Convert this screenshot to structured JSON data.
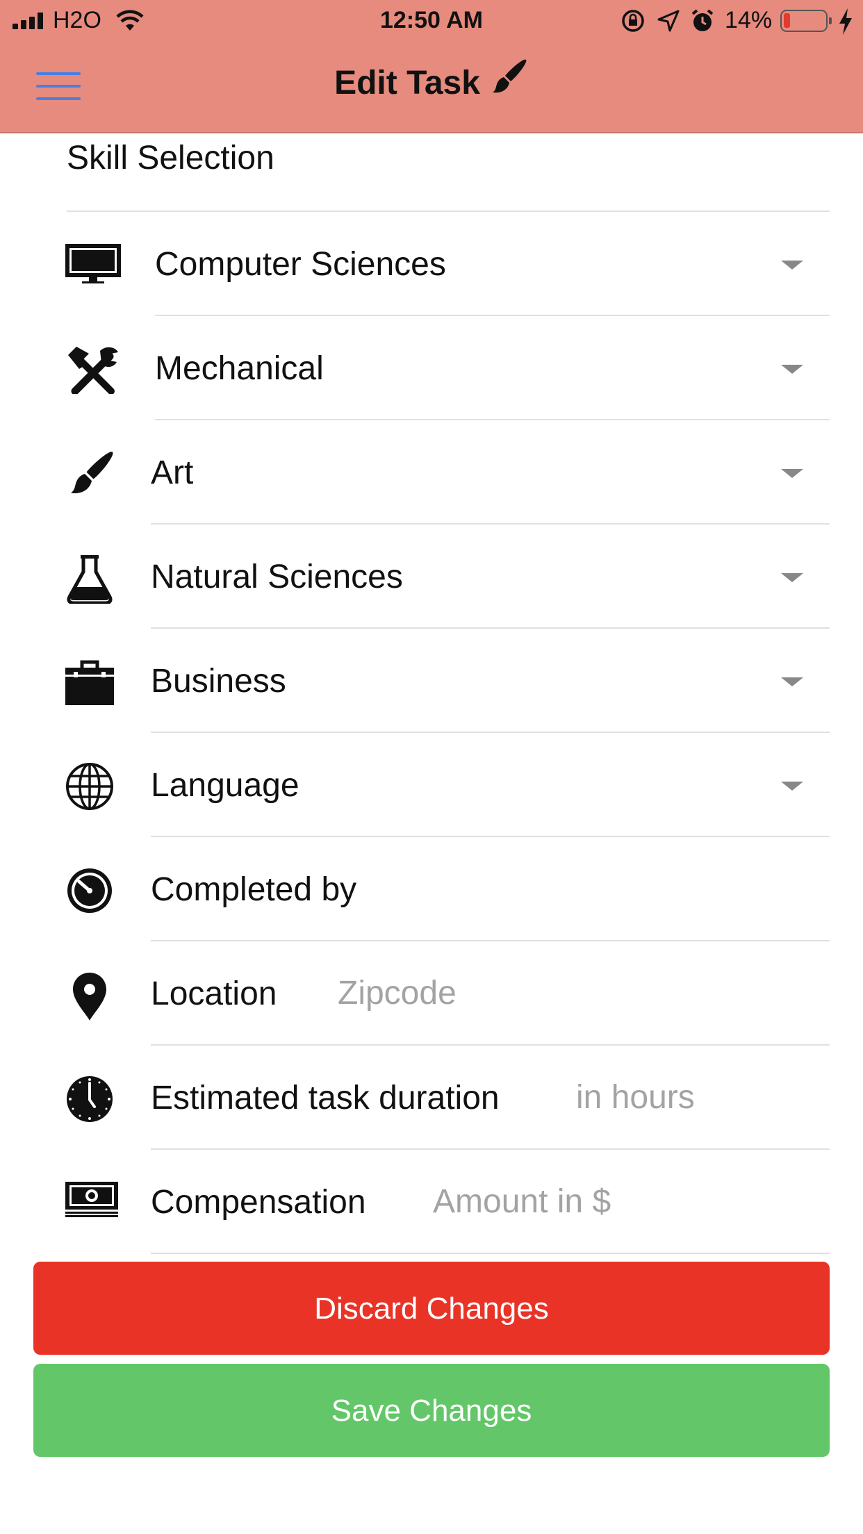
{
  "status_bar": {
    "carrier": "H2O",
    "time": "12:50 AM",
    "battery_percent": "14%",
    "battery_level": 0.14
  },
  "header": {
    "title": "Edit Task",
    "menu_icon": "hamburger-menu-icon",
    "title_icon": "paintbrush-icon",
    "background": "#e68b7e"
  },
  "form": {
    "section_title": "Skill Selection",
    "skills": [
      {
        "label": "Computer Sciences",
        "icon": "monitor-icon"
      },
      {
        "label": "Mechanical",
        "icon": "tools-icon"
      },
      {
        "label": "Art",
        "icon": "paintbrush-icon"
      },
      {
        "label": "Natural Sciences",
        "icon": "flask-icon"
      },
      {
        "label": "Business",
        "icon": "briefcase-icon"
      },
      {
        "label": "Language",
        "icon": "globe-icon"
      }
    ],
    "completed_by": {
      "label": "Completed by",
      "icon": "stopwatch-icon"
    },
    "location": {
      "label": "Location",
      "placeholder": "Zipcode",
      "value": "",
      "icon": "map-pin-icon"
    },
    "duration": {
      "label": "Estimated task duration",
      "placeholder": "in hours",
      "value": "",
      "icon": "clock-icon"
    },
    "compensation": {
      "label": "Compensation",
      "placeholder": "Amount in $",
      "value": "",
      "icon": "money-icon"
    }
  },
  "actions": {
    "discard_label": "Discard Changes",
    "save_label": "Save Changes",
    "discard_color": "#e83326",
    "save_color": "#63c769"
  }
}
